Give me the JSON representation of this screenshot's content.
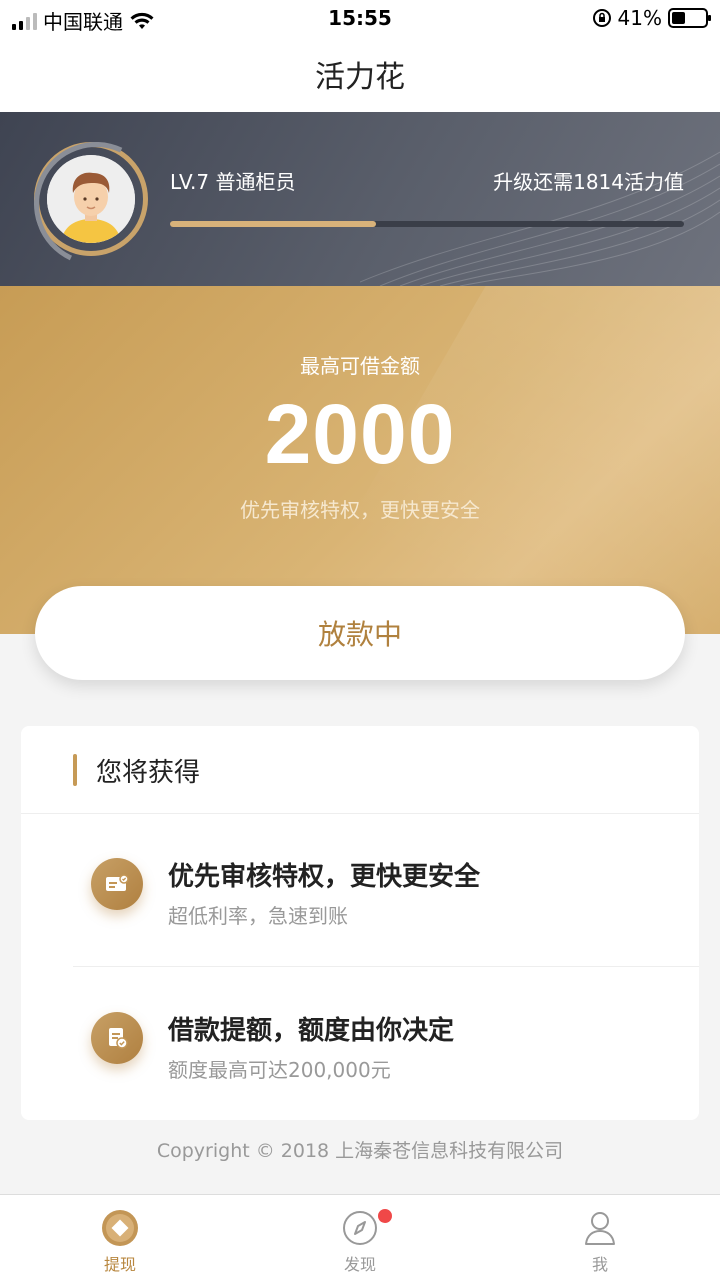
{
  "status_bar": {
    "carrier": "中国联通",
    "time": "15:55",
    "battery_percent": "41%",
    "battery_level": 0.41
  },
  "nav": {
    "title": "活力花"
  },
  "profile": {
    "level": "LV.7 普通柜员",
    "upgrade_hint": "升级还需1814活力值",
    "progress_fraction": 0.4
  },
  "hero": {
    "label": "最高可借金额",
    "amount": "2000",
    "subtitle": "优先审核特权，更快更安全"
  },
  "loan_button": {
    "label": "放款中"
  },
  "benefits": {
    "title": "您将获得",
    "items": [
      {
        "title": "优先审核特权，更快更安全",
        "desc": "超低利率，急速到账",
        "icon": "id-card-icon"
      },
      {
        "title": "借款提额，额度由你决定",
        "desc": "额度最高可达200,000元",
        "icon": "document-check-icon"
      }
    ]
  },
  "copyright": "Copyright © 2018 上海秦苍信息科技有限公司",
  "tabs": [
    {
      "label": "提现",
      "icon": "diamond-coin-icon",
      "active": true
    },
    {
      "label": "发现",
      "icon": "compass-icon",
      "active": false,
      "badge": true
    },
    {
      "label": "我",
      "icon": "person-icon",
      "active": false
    }
  ],
  "colors": {
    "accent": "#b8873f",
    "gold": "#d9b474",
    "dark_band": "#4a4f5b",
    "badge": "#f04848"
  }
}
